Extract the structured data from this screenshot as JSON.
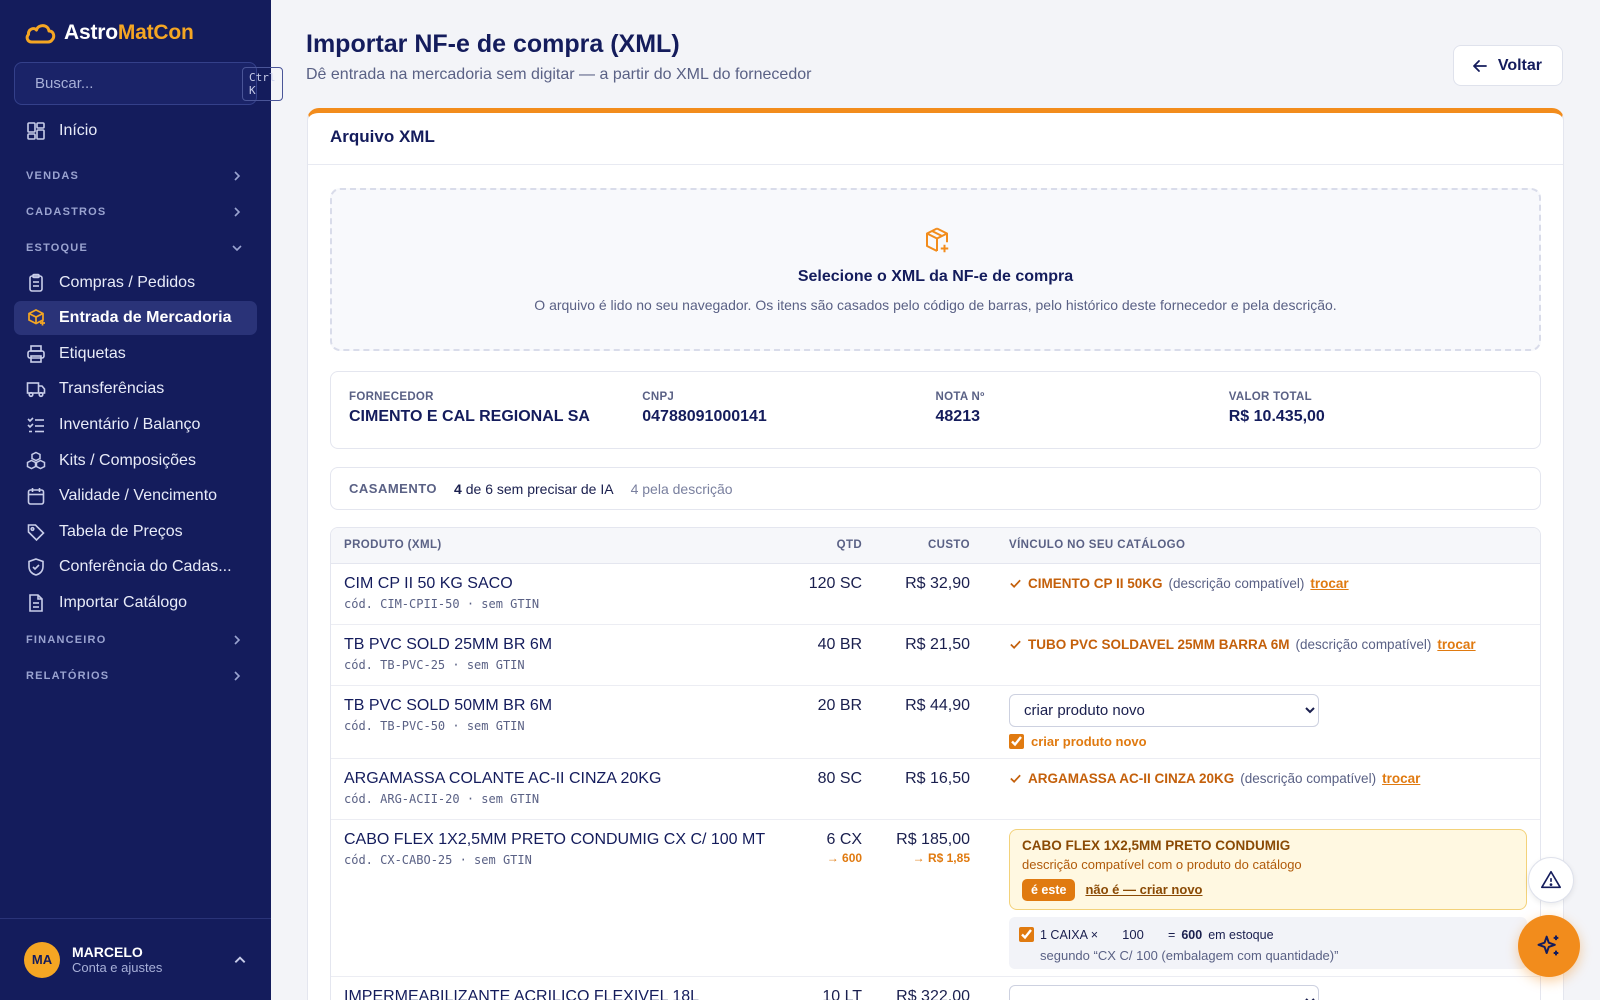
{
  "brand": {
    "name_a": "Astro",
    "name_b": "MatCon"
  },
  "search": {
    "placeholder": "Buscar...",
    "shortcut": "Ctrl K"
  },
  "sidebar": {
    "home": "Início",
    "sections": {
      "vendas": "VENDAS",
      "cadastros": "CADASTROS",
      "estoque": "ESTOQUE",
      "financeiro": "FINANCEIRO",
      "relatorios": "RELATÓRIOS"
    },
    "estoque_items": [
      {
        "label": "Compras / Pedidos",
        "icon": "clipboard-icon"
      },
      {
        "label": "Entrada de Mercadoria",
        "icon": "box-icon"
      },
      {
        "label": "Etiquetas",
        "icon": "printer-icon"
      },
      {
        "label": "Transferências",
        "icon": "truck-icon"
      },
      {
        "label": "Inventário / Balanço",
        "icon": "checklist-icon"
      },
      {
        "label": "Kits / Composições",
        "icon": "boxes-icon"
      },
      {
        "label": "Validade / Vencimento",
        "icon": "calendar-icon"
      },
      {
        "label": "Tabela de Preços",
        "icon": "tag-icon"
      },
      {
        "label": "Conferência do Cadas...",
        "icon": "shield-icon"
      },
      {
        "label": "Importar Catálogo",
        "icon": "file-icon"
      }
    ],
    "active_item": "Entrada de Mercadoria"
  },
  "user": {
    "initials": "MA",
    "name": "MARCELO",
    "subtitle": "Conta e ajustes"
  },
  "page": {
    "title": "Importar NF-e de compra (XML)",
    "subtitle": "Dê entrada na mercadoria sem digitar — a partir do XML do fornecedor",
    "back_label": "Voltar"
  },
  "card": {
    "title": "Arquivo XML"
  },
  "dropzone": {
    "title": "Selecione o XML da NF-e de compra",
    "description": "O arquivo é lido no seu navegador. Os itens são casados pelo código de barras, pelo histórico deste fornecedor e pela descrição."
  },
  "invoice": {
    "supplier_label": "FORNECEDOR",
    "supplier": "CIMENTO E CAL REGIONAL SA",
    "cnpj_label": "CNPJ",
    "cnpj": "04788091000141",
    "number_label": "NOTA Nº",
    "number": "48213",
    "total_label": "VALOR TOTAL",
    "total": "R$ 10.435,00"
  },
  "matching": {
    "label": "CASAMENTO",
    "count": "4",
    "summary": "de 6 sem precisar de IA",
    "by_description": "4 pela descrição"
  },
  "table": {
    "headers": {
      "product": "PRODUTO (XML)",
      "qty": "QTD",
      "cost": "CUSTO",
      "link": "VÍNCULO NO SEU CATÁLOGO"
    },
    "rows": [
      {
        "name": "CIM CP II 50 KG SACO",
        "code": "cód. CIM-CPII-50 · sem GTIN",
        "qty": "120 SC",
        "cost": "R$ 32,90",
        "link_name": "CIMENTO CP II 50KG",
        "link_hint": "(descrição compatível)",
        "swap": "trocar"
      },
      {
        "name": "TB PVC SOLD 25MM BR 6M",
        "code": "cód. TB-PVC-25 · sem GTIN",
        "qty": "40 BR",
        "cost": "R$ 21,50",
        "link_name": "TUBO PVC SOLDAVEL 25MM BARRA 6M",
        "link_hint": "(descrição compatível)",
        "swap": "trocar"
      },
      {
        "name": "TB PVC SOLD 50MM BR 6M",
        "code": "cód. TB-PVC-50 · sem GTIN",
        "qty": "20 BR",
        "cost": "R$ 44,90",
        "select_value": "criar produto novo",
        "check_label": "criar produto novo"
      },
      {
        "name": "ARGAMASSA COLANTE AC-II CINZA 20KG",
        "code": "cód. ARG-ACII-20 · sem GTIN",
        "qty": "80 SC",
        "cost": "R$ 16,50",
        "link_name": "ARGAMASSA AC-II CINZA 20KG",
        "link_hint": "(descrição compatível)",
        "swap": "trocar"
      },
      {
        "name": "CABO FLEX 1X2,5MM PRETO CONDUMIG CX C/ 100 MT",
        "code": "cód. CX-CABO-25 · sem GTIN",
        "qty": "6 CX",
        "qty_conv": "→ 600",
        "cost": "R$ 185,00",
        "cost_conv": "→ R$ 1,85",
        "suggest_name": "CABO FLEX 1X2,5MM PRETO CONDUMIG",
        "suggest_desc": "descrição compatível com o produto do catálogo",
        "suggest_yes": "é este",
        "suggest_no": "não é — criar novo",
        "pack_prefix": "1 CAIXA ×",
        "pack_value": "100",
        "pack_eq": "=",
        "pack_total": "600",
        "pack_suffix": "em estoque",
        "pack_note": "segundo “CX C/ 100 (embalagem com quantidade)”"
      },
      {
        "name": "IMPERMEABILIZANTE ACRILICO FLEXIVEL 18L",
        "code": "",
        "qty": "10 LT",
        "cost": "R$ 322,00"
      }
    ]
  },
  "colors": {
    "sidebar": "#141c5c",
    "accent": "#f28c1c",
    "link": "#c4600b"
  }
}
